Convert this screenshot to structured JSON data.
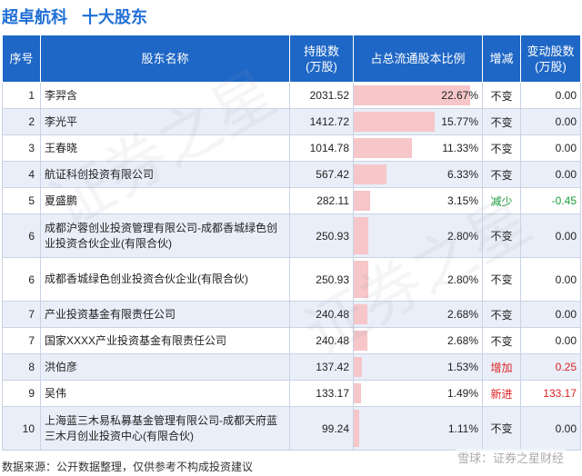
{
  "title": {
    "company": "超卓航科",
    "subtitle": "十大股东"
  },
  "table": {
    "headers": {
      "idx": "序号",
      "name": "股东名称",
      "shares_1": "持股数",
      "shares_2": "(万股)",
      "ratio": "占总流通股本比例",
      "change": "增减",
      "delta_1": "变动股数",
      "delta_2": "(万股)"
    },
    "rows": [
      {
        "idx": "1",
        "name": "李羿含",
        "shares": "2031.52",
        "ratio": "22.67%",
        "ratio_value": 22.67,
        "change": "不变",
        "delta": "0.00",
        "status": "same"
      },
      {
        "idx": "2",
        "name": "李光平",
        "shares": "1412.72",
        "ratio": "15.77%",
        "ratio_value": 15.77,
        "change": "不变",
        "delta": "0.00",
        "status": "same"
      },
      {
        "idx": "3",
        "name": "王春晓",
        "shares": "1014.78",
        "ratio": "11.33%",
        "ratio_value": 11.33,
        "change": "不变",
        "delta": "0.00",
        "status": "same"
      },
      {
        "idx": "4",
        "name": "航证科创投资有限公司",
        "shares": "567.42",
        "ratio": "6.33%",
        "ratio_value": 6.33,
        "change": "不变",
        "delta": "0.00",
        "status": "same"
      },
      {
        "idx": "5",
        "name": "夏盛鹏",
        "shares": "282.11",
        "ratio": "3.15%",
        "ratio_value": 3.15,
        "change": "减少",
        "delta": "-0.45",
        "status": "down"
      },
      {
        "idx": "6",
        "name": "成都沪蓉创业投资管理有限公司-成都香城绿色创业投资合伙企业(有限合伙)",
        "shares": "250.93",
        "ratio": "2.80%",
        "ratio_value": 2.8,
        "change": "不变",
        "delta": "0.00",
        "status": "same"
      },
      {
        "idx": "6",
        "name": "成都香城绿色创业投资合伙企业(有限合伙)",
        "shares": "250.93",
        "ratio": "2.80%",
        "ratio_value": 2.8,
        "change": "不变",
        "delta": "0.00",
        "status": "same"
      },
      {
        "idx": "7",
        "name": "产业投资基金有限责任公司",
        "shares": "240.48",
        "ratio": "2.68%",
        "ratio_value": 2.68,
        "change": "不变",
        "delta": "0.00",
        "status": "same"
      },
      {
        "idx": "7",
        "name": "国家XXXX产业投资基金有限责任公司",
        "shares": "240.48",
        "ratio": "2.68%",
        "ratio_value": 2.68,
        "change": "不变",
        "delta": "0.00",
        "status": "same"
      },
      {
        "idx": "8",
        "name": "洪伯彦",
        "shares": "137.42",
        "ratio": "1.53%",
        "ratio_value": 1.53,
        "change": "增加",
        "delta": "0.25",
        "status": "up"
      },
      {
        "idx": "9",
        "name": "吴伟",
        "shares": "133.17",
        "ratio": "1.49%",
        "ratio_value": 1.49,
        "change": "新进",
        "delta": "133.17",
        "status": "up"
      },
      {
        "idx": "10",
        "name": "上海蓝三木易私募基金管理有限公司-成都天府蓝三木月创业投资中心(有限合伙)",
        "shares": "99.24",
        "ratio": "1.11%",
        "ratio_value": 1.11,
        "change": "不变",
        "delta": "0.00",
        "status": "same"
      }
    ]
  },
  "footer": {
    "source": "数据来源：公开数据整理，仅供参考不构成投资建议"
  },
  "watermark": {
    "corner": "雪球：证券之星财经",
    "diagonal": "证券之星"
  },
  "colors": {
    "header_bg": "#1f67c6",
    "title": "#1f6fd6",
    "bar": "#f6c6c9",
    "up": "#e02222",
    "down": "#1a9e3a"
  }
}
